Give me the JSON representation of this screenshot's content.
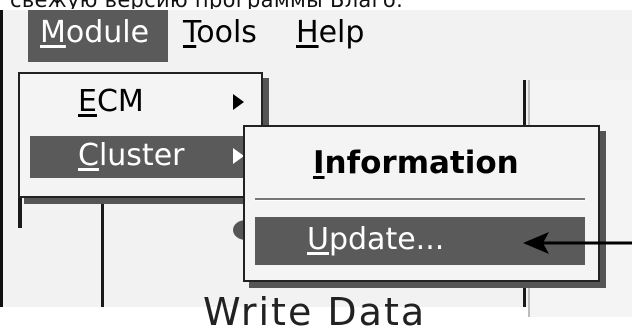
{
  "caption": {
    "text": "свежую версию программы Благо."
  },
  "menubar": {
    "items": [
      {
        "label": "Module",
        "mnemonic": "M",
        "rest": "odule",
        "active": true
      },
      {
        "label": "Tools",
        "mnemonic": "T",
        "rest": "ools",
        "active": false
      },
      {
        "label": "Help",
        "mnemonic": "H",
        "rest": "elp",
        "active": false
      }
    ]
  },
  "module_menu": {
    "items": [
      {
        "label": "ECM",
        "mnemonic": "E",
        "rest": "CM",
        "has_submenu": true,
        "selected": false
      },
      {
        "label": "Cluster",
        "mnemonic": "C",
        "rest": "luster",
        "has_submenu": true,
        "selected": true
      }
    ]
  },
  "cluster_submenu": {
    "information": {
      "label": "Information",
      "mnemonic": "I",
      "rest": "nformation"
    },
    "update": {
      "label": "Update...",
      "mnemonic": "U",
      "rest": "pdate..."
    }
  },
  "background": {
    "big_text": "Write Data"
  },
  "colors": {
    "highlight": "#5a5a5a",
    "menu_bg": "#f4f4f4",
    "app_bg": "#f2f2f2"
  },
  "icons": {
    "submenu_arrow": "triangle-right-icon",
    "callout": "left-arrow-icon"
  }
}
